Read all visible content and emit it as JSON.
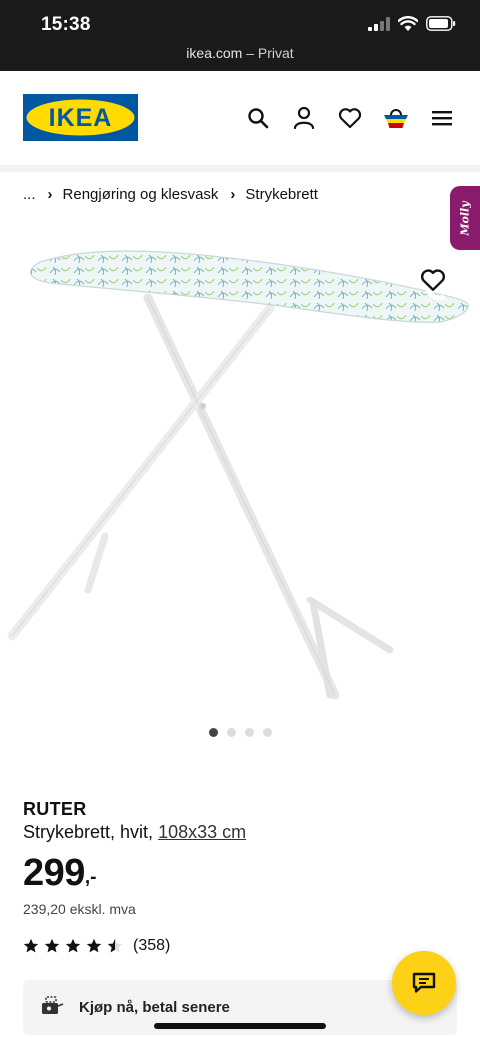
{
  "status_bar": {
    "time": "15:38"
  },
  "browser": {
    "url_host": "ikea.com",
    "url_mode": "– Privat"
  },
  "header": {
    "logo_text": "IKEA",
    "icons": [
      "search-icon",
      "account-icon",
      "heart-icon",
      "basket-icon",
      "menu-icon"
    ]
  },
  "breadcrumb": {
    "items": [
      "...",
      "Rengjøring og klesvask",
      "Strykebrett"
    ],
    "separator": "›"
  },
  "assistant_tab": {
    "label": "Molly"
  },
  "carousel": {
    "count": 4,
    "active_index": 0
  },
  "product": {
    "name": "RUTER",
    "description": "Strykebrett, hvit,",
    "dimensions": "108x33 cm",
    "price": "299",
    "price_suffix": ",-",
    "price_excl_vat": "239,20 ekskl. mva",
    "rating": 4.5,
    "rating_count": "(358)"
  },
  "bnpl": {
    "label": "Kjøp nå, betal senere"
  },
  "colors": {
    "ikea_blue": "#0058a3",
    "ikea_yellow": "#ffdb00",
    "chat_button": "#fcd116",
    "assistant_tab": "#8a1a6b"
  }
}
